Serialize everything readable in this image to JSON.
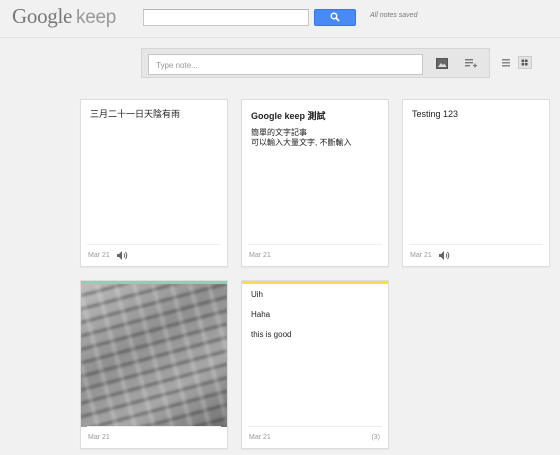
{
  "header": {
    "logo_google": "Google",
    "logo_keep": "keep",
    "search_value": "",
    "search_icon": "search-icon",
    "status_text": "All notes saved",
    "accent": "#4a8af4"
  },
  "composer": {
    "placeholder": "Type note...",
    "image_icon": "image-icon",
    "list_icon": "add-list-icon"
  },
  "view": {
    "list_icon": "list-view-icon",
    "grid_icon": "grid-view-icon",
    "selected": "grid"
  },
  "notes": [
    {
      "type": "audio",
      "text": "三月二十一日天陰有雨",
      "date": "Mar 21",
      "icon": "speaker-icon"
    },
    {
      "type": "text",
      "title": "Google keep 測試",
      "lines": [
        "簡單的文字記事",
        "可以輸入大量文字, 不斷輸入"
      ],
      "date": "Mar 21"
    },
    {
      "type": "audio",
      "text": "Testing 123",
      "date": "Mar 21",
      "icon": "speaker-icon"
    },
    {
      "type": "image",
      "color": "#8fd0b5",
      "date": "Mar 21"
    },
    {
      "type": "list",
      "color": "#f2e14a",
      "items": [
        "Uih",
        "Haha",
        "this is good"
      ],
      "date": "Mar 21",
      "count": "(3)"
    }
  ]
}
